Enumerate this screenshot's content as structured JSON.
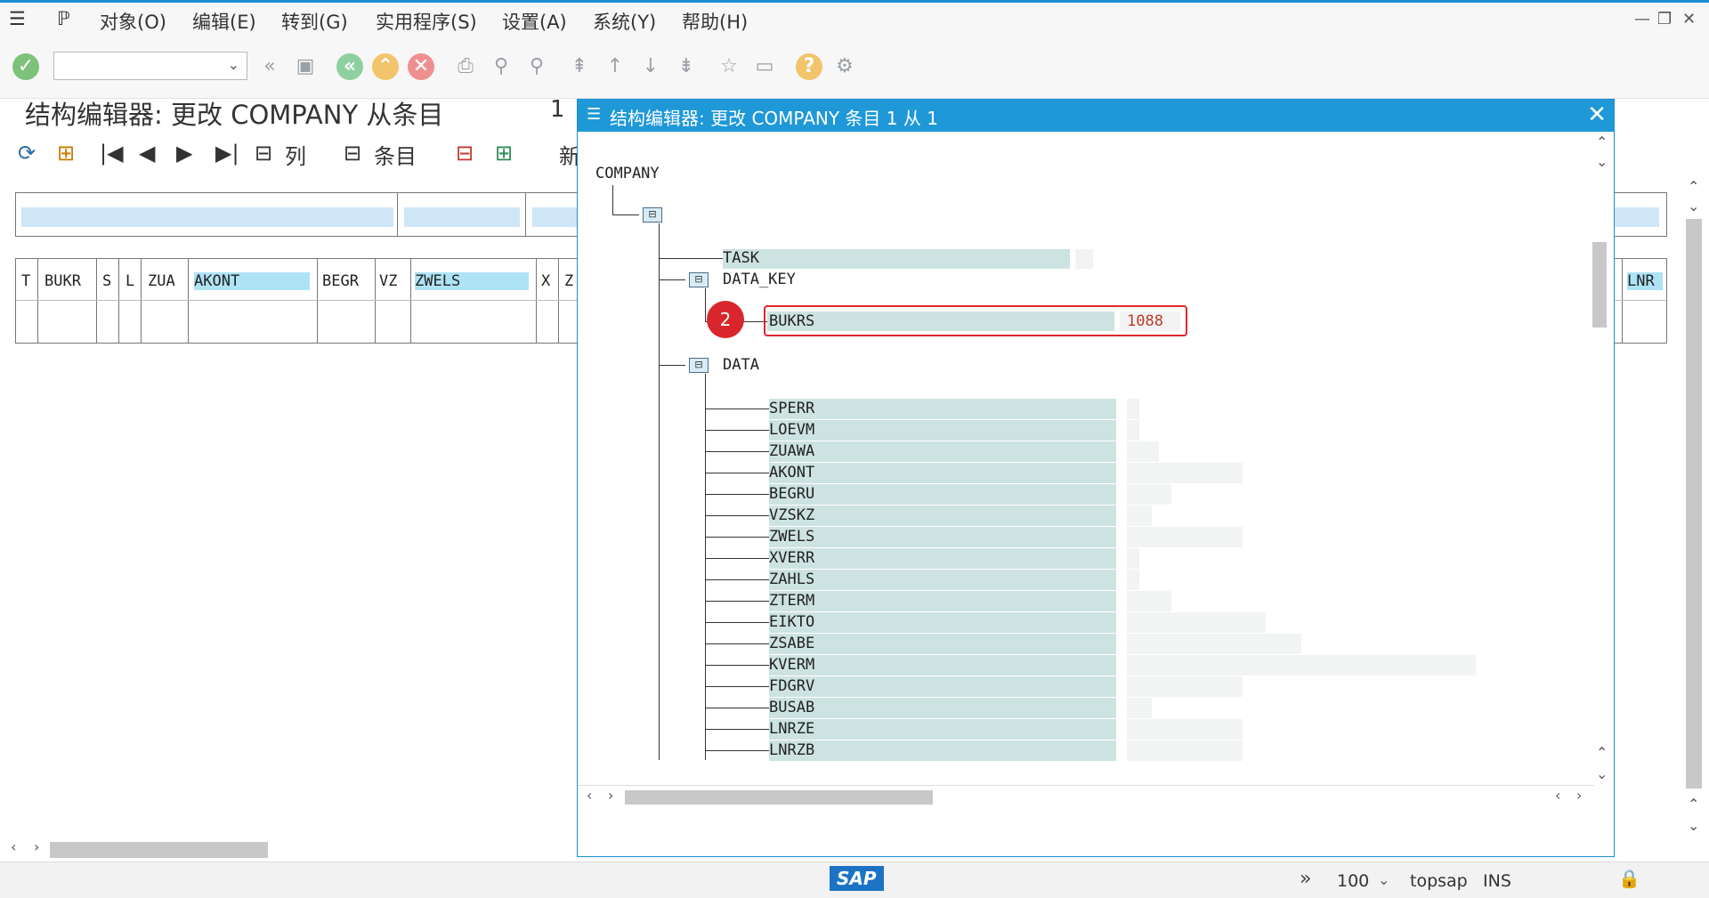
{
  "menu": {
    "items": [
      "对象(O)",
      "编辑(E)",
      "转到(G)",
      "实用程序(S)",
      "设置(A)",
      "系统(Y)",
      "帮助(H)"
    ]
  },
  "page": {
    "title": "结构编辑器: 更改 COMPANY 从条目",
    "entry_count": "1",
    "toolbar_col_label": "列",
    "toolbar_entry_label": "条目",
    "toolbar_new_label": "新"
  },
  "background_table": {
    "columns": [
      "T",
      "BUKR",
      "S",
      "L",
      "ZUA",
      "AKONT",
      "BEGR",
      "VZ",
      "ZWELS",
      "X",
      "Z"
    ],
    "right_column": "LNR"
  },
  "dialog": {
    "title": "结构编辑器: 更改 COMPANY 条目 1 从 1",
    "root": "COMPANY",
    "task_label": "TASK",
    "data_key_label": "DATA_KEY",
    "bukrs_label": "BUKRS",
    "bukrs_value": "1088",
    "data_label": "DATA",
    "data_fields": [
      "SPERR",
      "LOEVM",
      "ZUAWA",
      "AKONT",
      "BEGRU",
      "VZSKZ",
      "ZWELS",
      "XVERR",
      "ZAHLS",
      "ZTERM",
      "EIKTO",
      "ZSABE",
      "KVERM",
      "FDGRV",
      "BUSAB",
      "LNRZE",
      "LNRZB"
    ],
    "badge": "2"
  },
  "status": {
    "zoom": "100",
    "system": "topsap",
    "mode": "INS",
    "logo": "SAP"
  },
  "colors": {
    "accent": "#1f98d8",
    "highlight": "#e0262c",
    "field_bg": "#cde3e1"
  }
}
